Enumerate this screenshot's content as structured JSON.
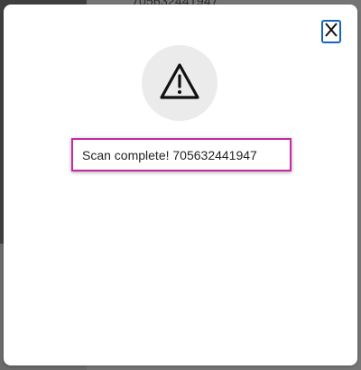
{
  "background": {
    "partial_text": "705632441947"
  },
  "dialog": {
    "close_icon": "close-x-icon",
    "status_icon": "warning-triangle-icon",
    "message": "Scan complete! 705632441947"
  },
  "colors": {
    "close_border": "#1565c0",
    "highlight_border": "#c32aa3",
    "icon_circle": "#ebebeb"
  }
}
